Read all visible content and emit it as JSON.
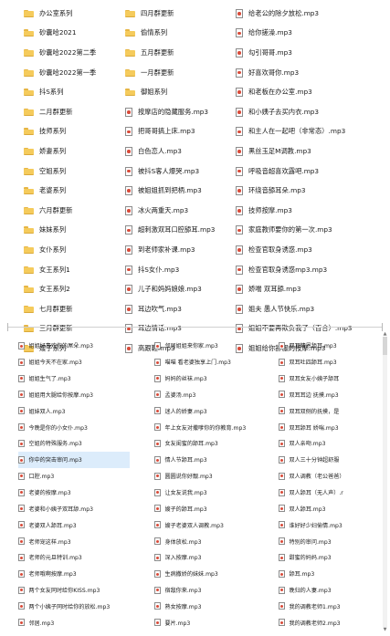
{
  "top_columns": [
    {
      "items": [
        {
          "type": "folder",
          "label": "办公室系列"
        },
        {
          "type": "folder",
          "label": "砂囊哈2021"
        },
        {
          "type": "folder",
          "label": "砂囊哈2022第二季"
        },
        {
          "type": "folder",
          "label": "砂囊哈2022第一季"
        },
        {
          "type": "folder",
          "label": "抖S系列"
        },
        {
          "type": "folder",
          "label": "二月群更新"
        },
        {
          "type": "folder",
          "label": "技师系列"
        },
        {
          "type": "folder",
          "label": "娇妻系列"
        },
        {
          "type": "folder",
          "label": "空姐系列"
        },
        {
          "type": "folder",
          "label": "老婆系列"
        },
        {
          "type": "folder",
          "label": "六月群更新"
        },
        {
          "type": "folder",
          "label": "妹妹系列"
        },
        {
          "type": "folder",
          "label": "女仆系列"
        },
        {
          "type": "folder",
          "label": "女王系列1"
        },
        {
          "type": "folder",
          "label": "女王系列2"
        },
        {
          "type": "folder",
          "label": "七月群更新"
        },
        {
          "type": "folder",
          "label": "三月群更新"
        },
        {
          "type": "folder",
          "label": "嫂子系列"
        }
      ]
    },
    {
      "items": [
        {
          "type": "folder",
          "label": "四月群更新"
        },
        {
          "type": "folder",
          "label": "偷情系列"
        },
        {
          "type": "folder",
          "label": "五月群更新"
        },
        {
          "type": "folder",
          "label": "一月群更新"
        },
        {
          "type": "folder",
          "label": "御姐系列"
        },
        {
          "type": "mp3",
          "label": "按摩店的隐藏服务.mp3"
        },
        {
          "type": "mp3",
          "label": "把哥哥搞上床.mp3"
        },
        {
          "type": "mp3",
          "label": "白色恋人.mp3"
        },
        {
          "type": "mp3",
          "label": "被抖S客人爆哭.mp3"
        },
        {
          "type": "mp3",
          "label": "被姐姐抓到把柄.mp3"
        },
        {
          "type": "mp3",
          "label": "冰火两重天.mp3"
        },
        {
          "type": "mp3",
          "label": "超刺激双耳口腔舔耳.mp3"
        },
        {
          "type": "mp3",
          "label": "到老师家补课.mp3"
        },
        {
          "type": "mp3",
          "label": "抖S女仆.mp3"
        },
        {
          "type": "mp3",
          "label": "儿子和妈妈娘娘.mp3"
        },
        {
          "type": "mp3",
          "label": "耳边吹气.mp3"
        },
        {
          "type": "mp3",
          "label": "耳边情话.mp3"
        },
        {
          "type": "mp3",
          "label": "高跟鞋.mp3"
        }
      ]
    },
    {
      "items": [
        {
          "type": "mp3",
          "label": "给老公的除夕放松.mp3"
        },
        {
          "type": "mp3",
          "label": "给你搓澡.mp3"
        },
        {
          "type": "mp3",
          "label": "勾引哥哥.mp3"
        },
        {
          "type": "mp3",
          "label": "好喜欢哥你.mp3"
        },
        {
          "type": "mp3",
          "label": "和老板在办公室.mp3"
        },
        {
          "type": "mp3",
          "label": "和小姨子去买内衣.mp3"
        },
        {
          "type": "mp3",
          "label": "和主人在一起吧（非常态）.mp3"
        },
        {
          "type": "mp3",
          "label": "黑丝玉足M调教.mp3"
        },
        {
          "type": "mp3",
          "label": "呼吸音超喜欢露吧.mp3"
        },
        {
          "type": "mp3",
          "label": "环绕音舔耳朵.mp3"
        },
        {
          "type": "mp3",
          "label": "技师按摩.mp3"
        },
        {
          "type": "mp3",
          "label": "家庭教师要你的第一次.mp3"
        },
        {
          "type": "mp3",
          "label": "检查官取身诱惑.mp3"
        },
        {
          "type": "mp3",
          "label": "检查官取身诱惑mp3.mp3"
        },
        {
          "type": "mp3",
          "label": "娇喘 双耳舔.mp3"
        },
        {
          "type": "mp3",
          "label": "姐夫 愚人节快乐.mp3"
        },
        {
          "type": "mp3",
          "label": "姐姐不要再欺负我了（百合）.mp3"
        },
        {
          "type": "mp3",
          "label": "姐姐给你舒服的按摩.mp3"
        }
      ]
    }
  ],
  "bottom_columns": [
    {
      "items": [
        {
          "label": "姐姐好喜欢你的屌朵.mp3"
        },
        {
          "label": "姐姐今天不在家.mp3"
        },
        {
          "label": "姐姐生气了.mp3"
        },
        {
          "label": "姐姐用大腿给你按摩.mp3"
        },
        {
          "label": "姐妹双人.mp3"
        },
        {
          "label": "今晚是你的小女仆.mp3"
        },
        {
          "label": "空姐的特殊服务.mp3"
        },
        {
          "label": "你中的突击审问.mp3"
        },
        {
          "label": "口腔.mp3"
        },
        {
          "label": "老婆的按摩.mp3"
        },
        {
          "label": "老婆和小姨子双耳舔.mp3"
        },
        {
          "label": "老婆双人舔耳.mp3"
        },
        {
          "label": "老师宠这样.mp3"
        },
        {
          "label": "老师的元旦特训.mp3"
        },
        {
          "label": "老师哦啊按摩.mp3"
        },
        {
          "label": "两个女友同时给你KISS.mp3"
        },
        {
          "label": "两个小姨子同时给你的放松.mp3"
        },
        {
          "label": "邻居.mp3"
        }
      ]
    },
    {
      "items": [
        {
          "label": "邻居姐姐来你家.mp3"
        },
        {
          "label": "喵喵 看老婆独享上门.mp3"
        },
        {
          "label": "妈妈的丝袜.mp3"
        },
        {
          "label": "孟婆汤.mp3"
        },
        {
          "label": "迷人的娇妻.mp3"
        },
        {
          "label": "年上女友对撒嗲你的你教育.mp3"
        },
        {
          "label": "女友闺蜜的舔耳.mp3"
        },
        {
          "label": "情人节舔耳.mp3"
        },
        {
          "label": "圆圆说你好靓.mp3"
        },
        {
          "label": "让女友说我.mp3"
        },
        {
          "label": "嫂子的舔耳.mp3"
        },
        {
          "label": "嫂子老婆双人调教.mp3"
        },
        {
          "label": "身体放松.mp3"
        },
        {
          "label": "深入按摩.mp3"
        },
        {
          "label": "生病撒娇的妹妹.mp3"
        },
        {
          "label": "宿敌你来.mp3"
        },
        {
          "label": "熟女按摩.mp3"
        },
        {
          "label": "要片.mp3"
        }
      ]
    },
    {
      "items": [
        {
          "label": "双耳精恩舔耳.mp3"
        },
        {
          "label": "双耳吐四舔耳.mp3"
        },
        {
          "label": "双耳女友小姨子舔耳"
        },
        {
          "label": "双耳耳边 抚摸.mp3"
        },
        {
          "label": "双耳双侧的抚摸，是"
        },
        {
          "label": "双耳舔耳 娇喘.mp3"
        },
        {
          "label": "双人亲吻.mp3"
        },
        {
          "label": "双人三十分钟超舒服"
        },
        {
          "label": "双人调教（老公爸爸）"
        },
        {
          "label": "双人舔耳（无人声）.r"
        },
        {
          "label": "双人舔耳.mp3"
        },
        {
          "label": "谁好好少妇偷情.mp3"
        },
        {
          "label": "特别的审问.mp3"
        },
        {
          "label": "甜蜜的妈妈.mp3"
        },
        {
          "label": "舔耳.mp3"
        },
        {
          "label": "晚归的人妻.mp3"
        },
        {
          "label": "我的调教老师1.mp3"
        },
        {
          "label": "我的调教老师2.mp3"
        }
      ]
    }
  ],
  "selected_bottom_item": "你中的突击审问.mp3",
  "colors": {
    "folder": "#f5cb5c",
    "mp3_icon_dot": "#d84b3a",
    "selection": "#dcecfb"
  }
}
